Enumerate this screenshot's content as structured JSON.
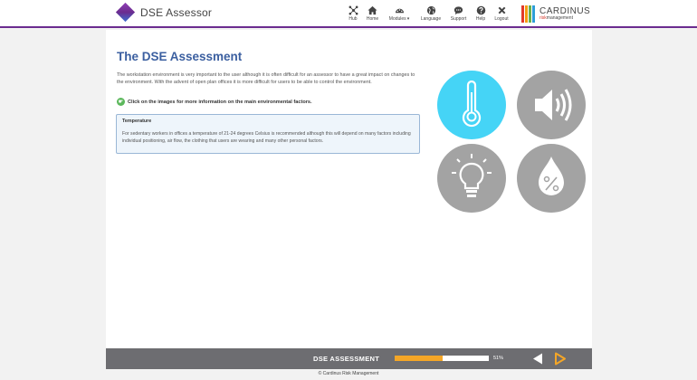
{
  "header": {
    "app_title": "DSE Assessor",
    "nav": [
      {
        "label": "Hub",
        "icon": "hub-icon",
        "caret": ""
      },
      {
        "label": "Home",
        "icon": "home-icon",
        "caret": ""
      },
      {
        "label": "Modules",
        "icon": "modules-icon",
        "caret": "▾"
      },
      {
        "label": "Language",
        "icon": "globe-icon",
        "caret": ""
      },
      {
        "label": "Support",
        "icon": "chat-bubble-icon",
        "caret": ""
      },
      {
        "label": "Help",
        "icon": "question-icon",
        "caret": ""
      },
      {
        "label": "Logout",
        "icon": "close-icon",
        "caret": ""
      }
    ],
    "brand": {
      "name": "CARDINUS",
      "sub_prefix": "risk",
      "sub_suffix": "management",
      "bar_colors": [
        "#e23a2a",
        "#f39c12",
        "#6ab04c",
        "#2d9ed8"
      ]
    }
  },
  "main": {
    "title": "The DSE Assessment",
    "intro": "The workstation environment is very important to the user although it is often difficult for an assessor to have a great impact on changes to the environment. With the advent of open plan offices it is more difficult for users to be able to control the environment.",
    "hint": "Click on the images for more information on the main environmental factors.",
    "info_box": {
      "title": "Temperature",
      "text": "For sedentary workers in offices a temperature of 21-24 degrees Celsius is recommended although this will depend on many factors including individual positioning, air flow, the clothing that users are wearing and many other personal factors."
    },
    "factors": [
      {
        "icon": "thermometer-icon",
        "selected": true
      },
      {
        "icon": "speaker-icon",
        "selected": false
      },
      {
        "icon": "lightbulb-icon",
        "selected": false
      },
      {
        "icon": "humidity-drop-icon",
        "selected": false
      }
    ],
    "colors": {
      "title": "#3b5fa0",
      "active_factor": "#45d4f6",
      "inactive_factor": "#a3a3a3",
      "accent": "#6b2c8f"
    }
  },
  "footer": {
    "title": "DSE ASSESSMENT",
    "progress_percent": 51,
    "progress_label": "51%",
    "colors": {
      "bar": "#6d6d71",
      "progress": "#f4a627",
      "next_arrow": "#f4a627",
      "prev_arrow": "#ffffff"
    },
    "copyright": "© Cardinus Risk Management"
  }
}
